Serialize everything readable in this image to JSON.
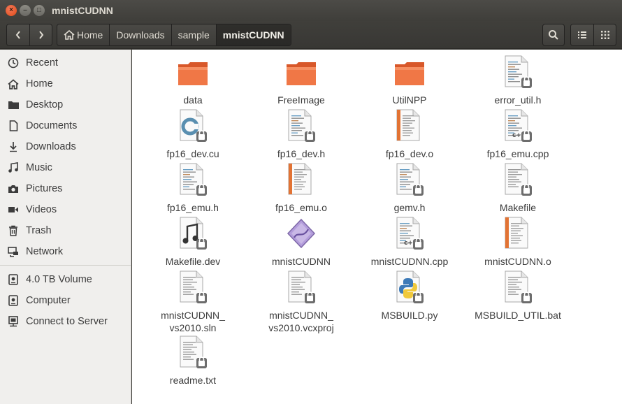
{
  "window": {
    "title": "mnistCUDNN",
    "close_glyph": "×",
    "min_glyph": "–",
    "max_glyph": "□"
  },
  "breadcrumbs": [
    "Home",
    "Downloads",
    "sample",
    "mnistCUDNN"
  ],
  "sidebar": {
    "places": [
      "Recent",
      "Home",
      "Desktop",
      "Documents",
      "Downloads",
      "Music",
      "Pictures",
      "Videos",
      "Trash",
      "Network"
    ],
    "devices": [
      "4.0 TB Volume",
      "Computer",
      "Connect to Server"
    ]
  },
  "files": [
    {
      "name": "data",
      "kind": "folder"
    },
    {
      "name": "FreeImage",
      "kind": "folder"
    },
    {
      "name": "UtilNPP",
      "kind": "folder"
    },
    {
      "name": "error_util.h",
      "kind": "header"
    },
    {
      "name": "fp16_dev.cu",
      "kind": "cuda"
    },
    {
      "name": "fp16_dev.h",
      "kind": "header"
    },
    {
      "name": "fp16_dev.o",
      "kind": "object"
    },
    {
      "name": "fp16_emu.cpp",
      "kind": "cpp"
    },
    {
      "name": "fp16_emu.h",
      "kind": "header"
    },
    {
      "name": "fp16_emu.o",
      "kind": "object"
    },
    {
      "name": "gemv.h",
      "kind": "header"
    },
    {
      "name": "Makefile",
      "kind": "text"
    },
    {
      "name": "Makefile.dev",
      "kind": "audio"
    },
    {
      "name": "mnistCUDNN",
      "kind": "executable"
    },
    {
      "name": "mnistCUDNN.cpp",
      "kind": "cpp"
    },
    {
      "name": "mnistCUDNN.o",
      "kind": "object"
    },
    {
      "name": "mnistCUDNN_\nvs2010.sln",
      "kind": "text"
    },
    {
      "name": "mnistCUDNN_\nvs2010.vcxproj",
      "kind": "text"
    },
    {
      "name": "MSBUILD.py",
      "kind": "python"
    },
    {
      "name": "MSBUILD_UTIL.bat",
      "kind": "text"
    },
    {
      "name": "readme.txt",
      "kind": "text"
    }
  ],
  "colors": {
    "accent": "#e95420",
    "folder": "#f07746",
    "sidebar_bg": "#f0efed",
    "header_bg": "#3c3b37"
  }
}
